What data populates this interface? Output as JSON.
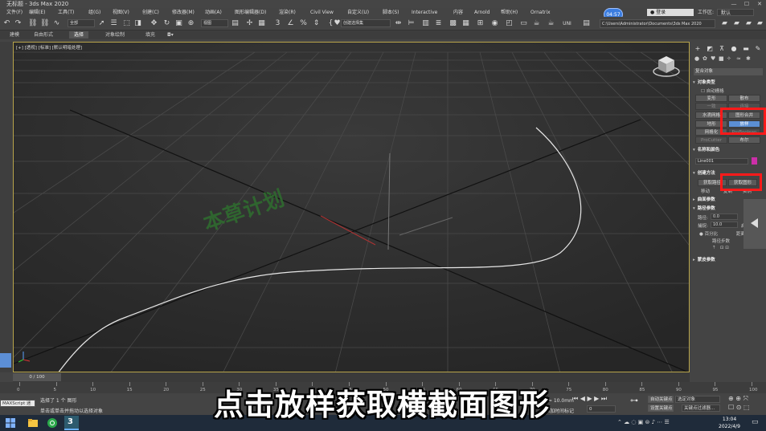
{
  "window": {
    "title": "无标题 - 3ds Max 2020",
    "controls": [
      "—",
      "☐",
      "✕"
    ]
  },
  "menu": {
    "items": [
      "文件(F)",
      "编辑(E)",
      "工具(T)",
      "组(G)",
      "视图(V)",
      "创建(C)",
      "修改器(M)",
      "动画(A)",
      "图形编辑器(D)",
      "渲染(R)",
      "Civil View",
      "自定义(U)",
      "脚本(S)",
      "Interactive",
      "内容",
      "Arnold",
      "帮助(H)",
      "Ornatrix"
    ],
    "clock_badge": "04:57",
    "login": "登录",
    "workspace_label": "工作区:",
    "workspace_value": "默认"
  },
  "toolbar": {
    "filter_select": "全部",
    "view_select": "视图",
    "selection_set": "创建选择集",
    "project_path": "C:\\Users\\Administrator\\Documents\\3ds Max 2020"
  },
  "ribbon": {
    "tabs": [
      "建模",
      "自由形式",
      "选择",
      "对象绘制",
      "填充"
    ],
    "active": "选择"
  },
  "viewport": {
    "label": "[+] [透视] [标准] [默认明暗处理]",
    "watermark": "本草计划"
  },
  "command_panel": {
    "dropdown": "复合对象",
    "object_type": {
      "header": "对象类型",
      "autogrid": "自动栅格",
      "buttons": [
        {
          "label": "变形",
          "state": "normal"
        },
        {
          "label": "散布",
          "state": "normal"
        },
        {
          "label": "一致",
          "state": "disabled"
        },
        {
          "label": "连接",
          "state": "disabled"
        },
        {
          "label": "水滴网格",
          "state": "normal"
        },
        {
          "label": "图形合并",
          "state": "normal"
        },
        {
          "label": "地形",
          "state": "normal"
        },
        {
          "label": "放样",
          "state": "active"
        },
        {
          "label": "网格化",
          "state": "normal"
        },
        {
          "label": "ProBoolean",
          "state": "disabled"
        },
        {
          "label": "ProCutter",
          "state": "disabled"
        },
        {
          "label": "布尔",
          "state": "normal"
        }
      ]
    },
    "name_color": {
      "header": "名称和颜色",
      "name": "Line001",
      "color": "#cc2fa8"
    },
    "creation_method": {
      "header": "创建方法",
      "get_path": "获取路径",
      "get_shape": "获取图形",
      "move": "移动",
      "copy": "复制",
      "instance": "实例"
    },
    "surface_params": {
      "header": "曲面参数"
    },
    "path_params": {
      "header": "路径参数",
      "path_label": "路径:",
      "path_value": "0.0",
      "snap_label": "捕捉:",
      "snap_value": "10.0",
      "enable": "启用",
      "percent": "百分比",
      "distance": "距离",
      "path_steps": "路径步数"
    },
    "skin_params": {
      "header": "蒙皮参数"
    }
  },
  "timeline": {
    "slider": "0 / 100",
    "ticks": [
      "0",
      "5",
      "10",
      "15",
      "20",
      "25",
      "30",
      "35",
      "40",
      "45",
      "50",
      "55",
      "60",
      "65",
      "70",
      "75",
      "80",
      "85",
      "90",
      "95",
      "100"
    ]
  },
  "status": {
    "script_label": "MAXScript 迷",
    "selected": "选择了 1 个 图形",
    "hint": "单击或单击并拖动以选择对象",
    "grid_label": "栅格 = 10.0mm",
    "add_time_tag": "添加时间标记",
    "auto_key": "自动关键点",
    "set_key": "设置关键点",
    "selected_object": "选定对象",
    "key_filters": "关键点过滤器...",
    "frame": "0"
  },
  "subtitle": "点击放样获取横截面图形",
  "taskbar": {
    "time": "13:04",
    "date": "2022/4/9"
  },
  "colors": {
    "viewport_bg": "#2b2b2b",
    "viewport_border": "#b8a44a",
    "highlight": "#ff1a1a",
    "active_btn": "#5b8fd3"
  }
}
